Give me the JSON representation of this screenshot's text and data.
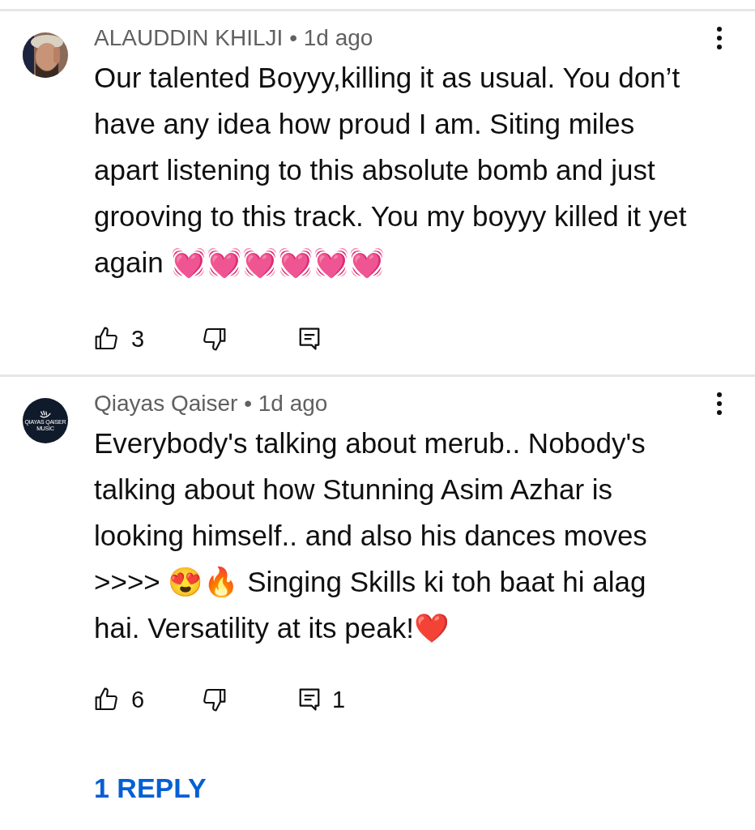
{
  "comments": [
    {
      "author": "ALAUDDIN KHILJI",
      "separator": "•",
      "time": "1d ago",
      "body": "Our talented Boyyy,killing it as usual. You don’t have any idea how proud I am. Siting miles apart listening to this absolute bomb and just grooving to this track. You my boyyy killed it yet again 💓💓💓💓💓💓",
      "likes": "3"
    },
    {
      "author": "Qiayas Qaiser",
      "separator": "•",
      "time": "1d ago",
      "avatar": {
        "kind": "logo",
        "lines": [
          "QIAYAS QAISER",
          "MUSIC"
        ]
      },
      "body": "Everybody's talking about merub.. Nobody's talking about how Stunning Asim Azhar is looking himself.. and also his dances moves >>>> 😍🔥 Singing Skills ki toh baat hi alag hai. Versatility at its peak!❤️",
      "likes": "6",
      "replies": "1",
      "reply_link": "1 REPLY"
    }
  ]
}
